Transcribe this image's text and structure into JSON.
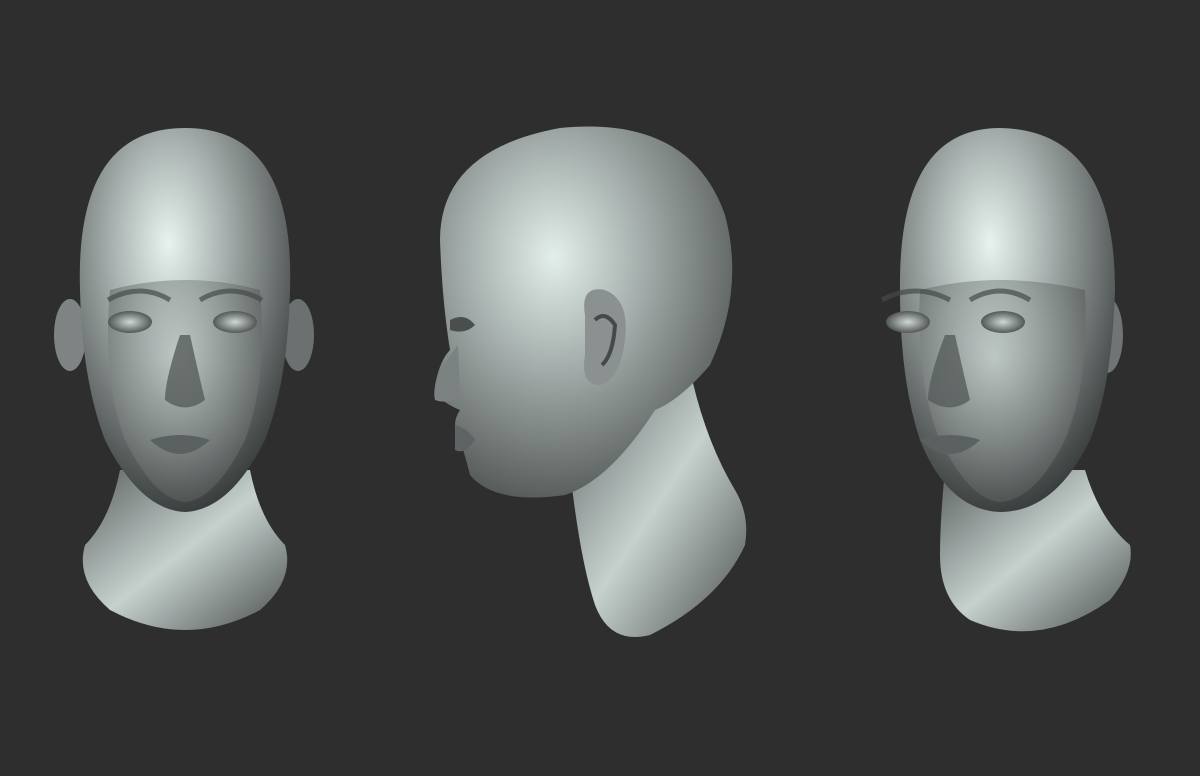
{
  "scene": {
    "background_color": "#2e2e2e",
    "material_color": "#9aa0a0",
    "highlight_color": "#e6f2ee",
    "shadow_color": "#2a2c2c",
    "views": [
      {
        "name": "front-view",
        "orientation": "front"
      },
      {
        "name": "side-view",
        "orientation": "left-profile"
      },
      {
        "name": "three-quarter-view",
        "orientation": "front-slightly-turned"
      }
    ]
  }
}
